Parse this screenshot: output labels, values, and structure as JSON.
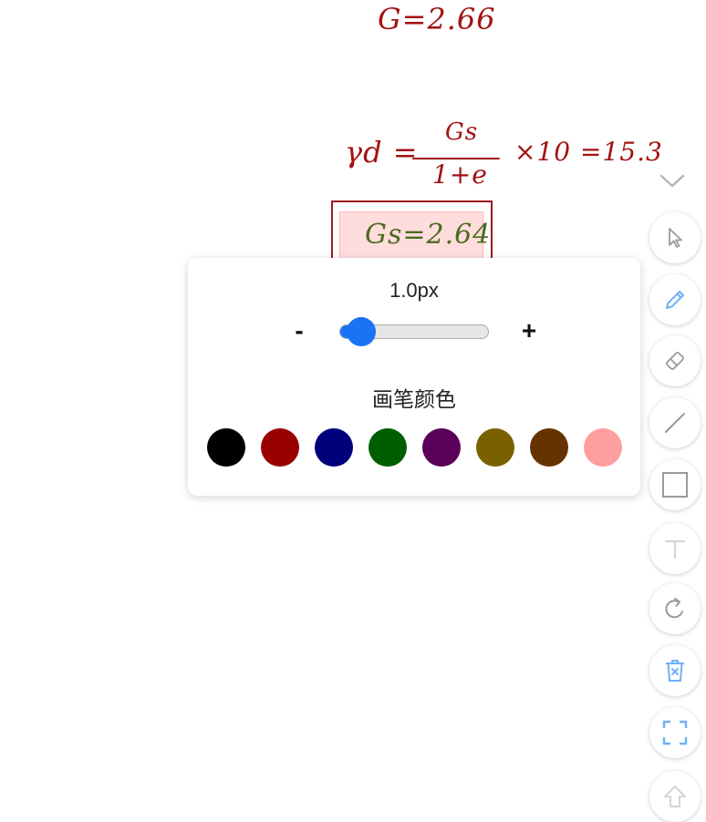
{
  "canvas": {
    "line1": "G=2.66",
    "line2_left": "γd =",
    "line2_numerator": "Gs",
    "line2_denominator": "1+e",
    "line2_right": "×10 =15.3",
    "highlighted_text": "Gs=2.64"
  },
  "pen_panel": {
    "width_value": "1.0px",
    "minus_label": "-",
    "plus_label": "+",
    "slider_level_percent": 15,
    "color_label": "画笔颜色",
    "colors": [
      "#000000",
      "#9b0000",
      "#00007a",
      "#005e00",
      "#5a005a",
      "#7a6100",
      "#663300",
      "#ff9e9e"
    ]
  },
  "toolbar": {
    "collapse_icon": "chevron-down-icon",
    "tools": [
      {
        "name": "select",
        "icon": "pointer-icon",
        "active": false
      },
      {
        "name": "pen",
        "icon": "pencil-icon",
        "active": true
      },
      {
        "name": "eraser",
        "icon": "eraser-icon",
        "active": false
      },
      {
        "name": "line",
        "icon": "line-icon",
        "active": false
      },
      {
        "name": "rectangle",
        "icon": "rectangle-icon",
        "active": false
      },
      {
        "name": "text",
        "icon": "text-icon",
        "active": false
      },
      {
        "name": "undo",
        "icon": "rotate-icon",
        "active": false
      },
      {
        "name": "clear",
        "icon": "trash-icon",
        "active": false
      },
      {
        "name": "fullscreen",
        "icon": "fullscreen-icon",
        "active": false
      },
      {
        "name": "upload",
        "icon": "upload-arrow-icon",
        "active": false
      }
    ],
    "colors": {
      "icon_gray": "#9a9a9a",
      "icon_blue": "#6fb1f5",
      "icon_light": "#cfd6dc"
    }
  }
}
